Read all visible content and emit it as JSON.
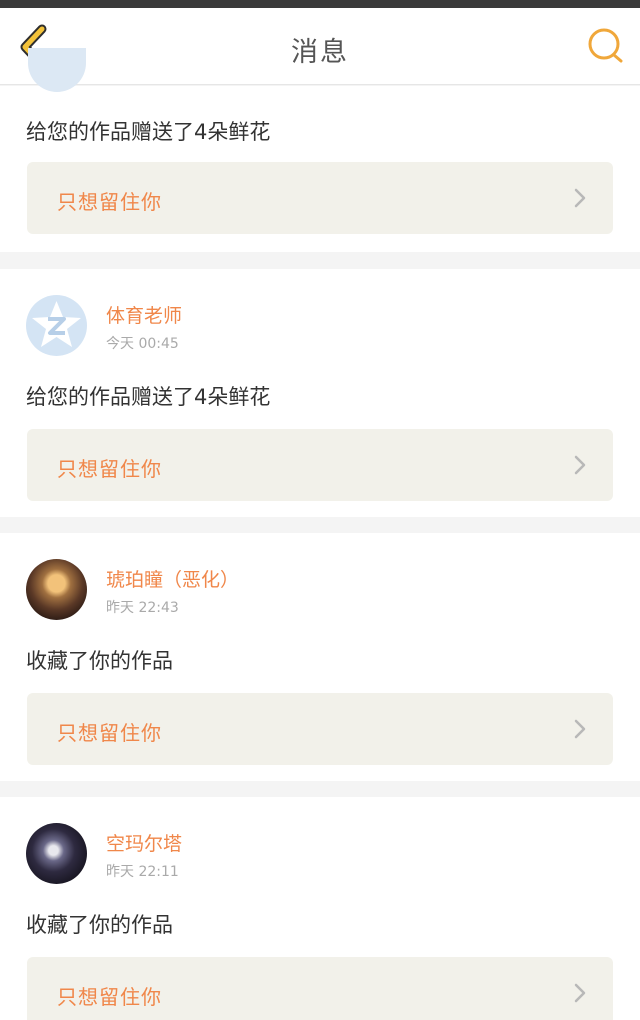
{
  "header": {
    "title": "消息",
    "back_icon": "chevron-left-icon",
    "search_icon": "search-icon",
    "accent_color": "#f0a73a"
  },
  "messages": [
    {
      "action": "给您的作品赠送了4朵鲜花",
      "reply_label": "只想留住你"
    },
    {
      "user": "体育老师",
      "time": "今天 00:45",
      "action": "给您的作品赠送了4朵鲜花",
      "reply_label": "只想留住你"
    },
    {
      "user": "琥珀瞳（恶化）",
      "time": "昨天 22:43",
      "action": "收藏了你的作品",
      "reply_label": "只想留住你"
    },
    {
      "user": "空玛尔塔",
      "time": "昨天 22:11",
      "action": "收藏了你的作品",
      "reply_label": "只想留住你"
    }
  ],
  "colors": {
    "username": "#f0874a",
    "reply_box_bg": "#f2f1ea",
    "separator_bg": "#f4f4f4"
  }
}
